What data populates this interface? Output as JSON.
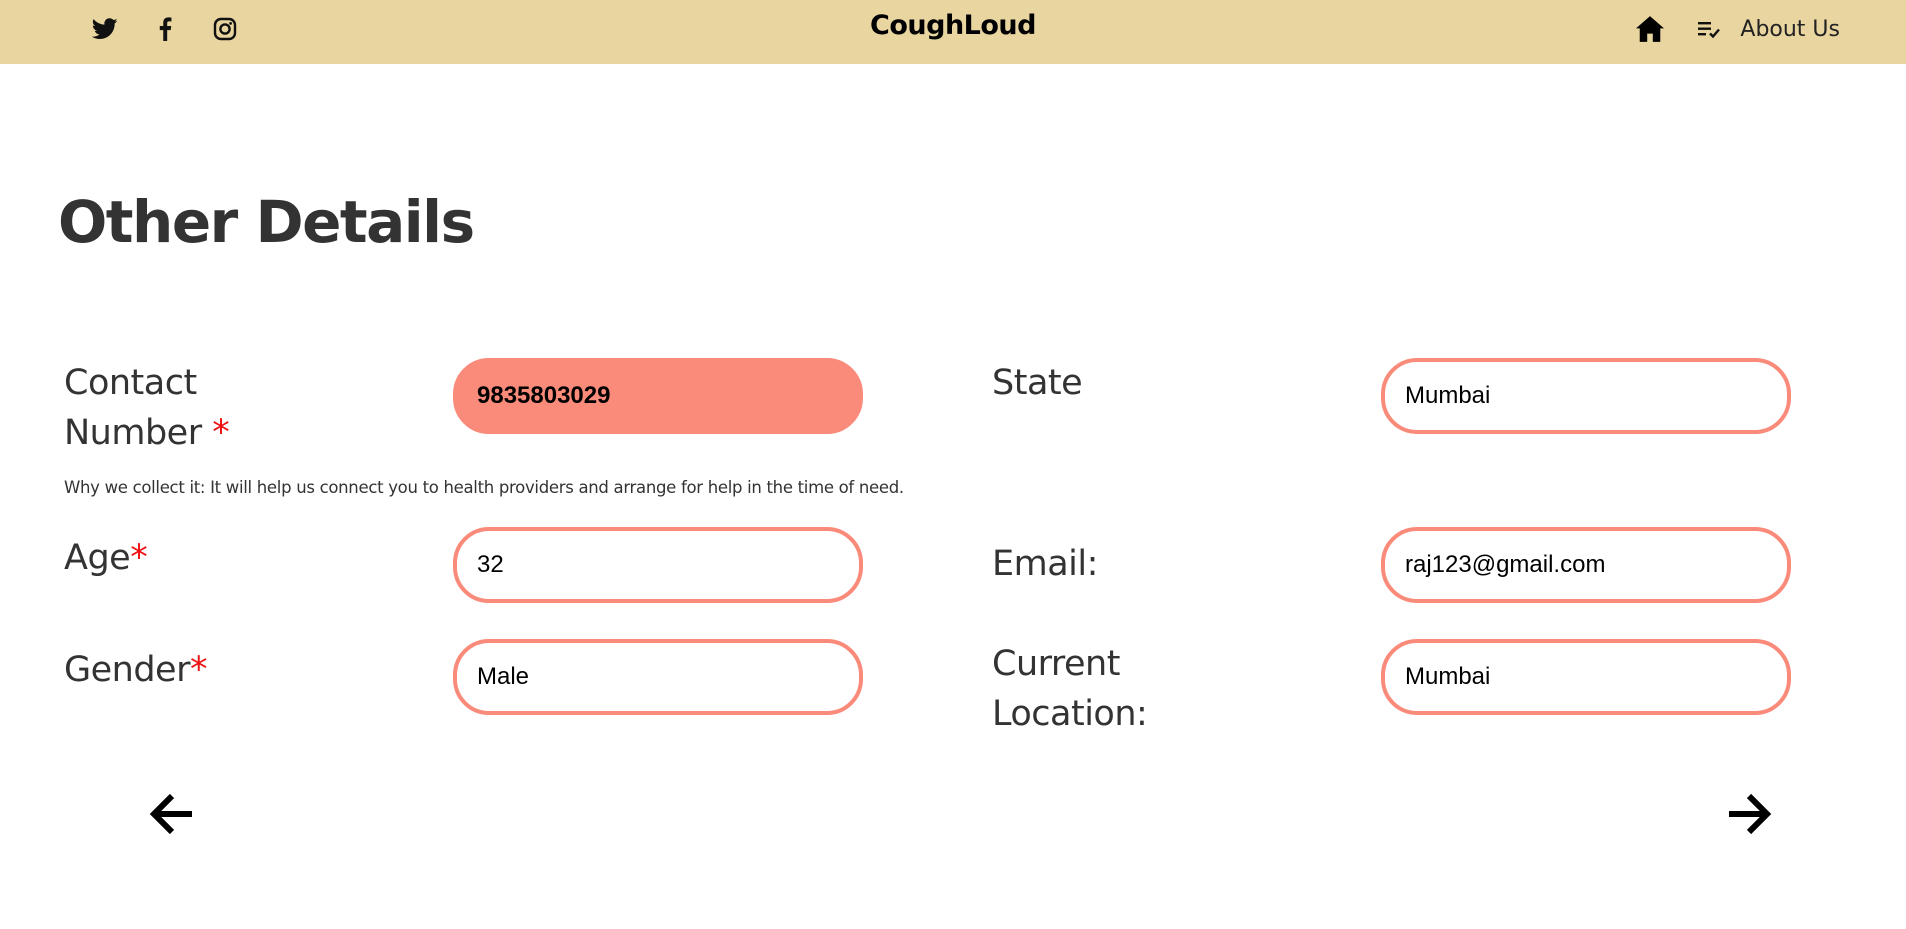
{
  "navbar": {
    "brand": "CoughLoud",
    "about_label": "About Us",
    "social_icons": [
      "twitter-icon",
      "facebook-icon",
      "instagram-icon"
    ],
    "nav_icons": [
      "home-icon",
      "playlist-check-icon"
    ],
    "background": "#e8d5a0"
  },
  "page": {
    "title": "Other Details"
  },
  "form": {
    "contact": {
      "label_line1": "Contact",
      "label_line2": "Number",
      "required_mark": "*",
      "value": "9835803029",
      "hint": "Why we collect it: It will help us connect you to health providers and arrange for help in the time of need."
    },
    "age": {
      "label": "Age",
      "required_mark": "*",
      "value": "32"
    },
    "gender": {
      "label": "Gender",
      "required_mark": "*",
      "value": "Male"
    },
    "state": {
      "label": "State",
      "value": "Mumbai"
    },
    "email": {
      "label": "Email:",
      "value": "raj123@gmail.com"
    },
    "current_location": {
      "label_line1": "Current",
      "label_line2": "Location:",
      "value": "Mumbai"
    },
    "accent_color": "#fa8a7a"
  },
  "navigation": {
    "back_icon": "arrow-left-icon",
    "next_icon": "arrow-right-icon"
  }
}
